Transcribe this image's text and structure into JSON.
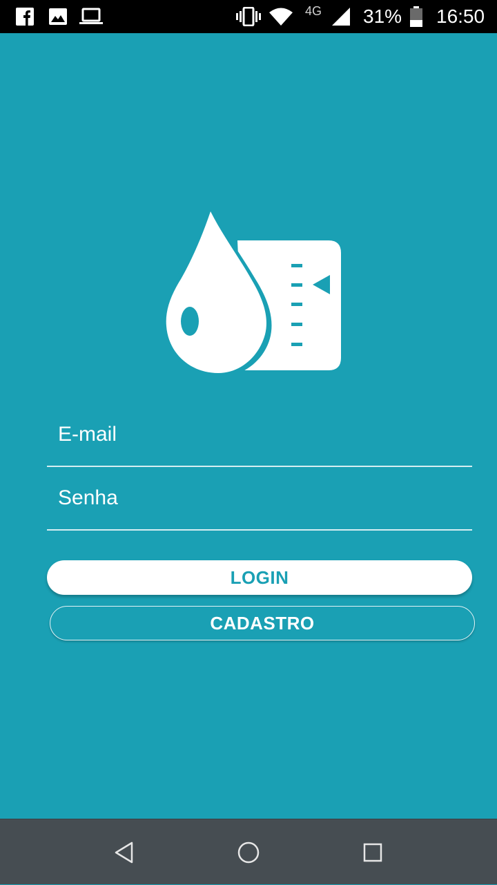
{
  "status_bar": {
    "icons_left": [
      "facebook-icon",
      "gallery-icon",
      "laptop-icon"
    ],
    "icons_right": [
      "vibrate-icon",
      "wifi-icon",
      "signal-icon",
      "battery-icon"
    ],
    "network": "4G",
    "battery": "31%",
    "time": "16:50"
  },
  "login": {
    "logo_icon": "water-drop-gauge-icon",
    "email_placeholder": "E-mail",
    "email_value": "",
    "password_placeholder": "Senha",
    "password_value": "",
    "login_label": "LOGIN",
    "register_label": "CADASTRO"
  },
  "nav_bar": {
    "back_icon": "back-triangle-icon",
    "home_icon": "home-circle-icon",
    "recents_icon": "recents-square-icon"
  },
  "colors": {
    "background": "#1aa0b4",
    "button_bg": "#ffffff",
    "status_bar": "#000000",
    "nav_bar": "#464d52"
  }
}
